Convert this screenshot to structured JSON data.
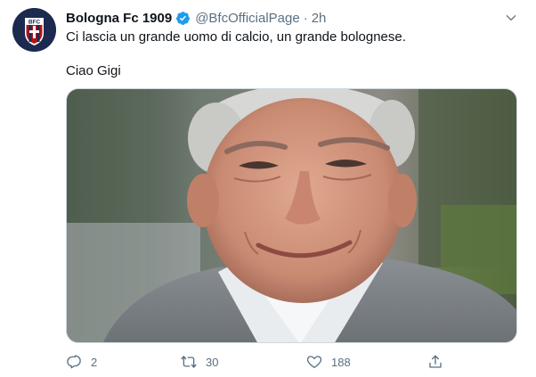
{
  "tweet": {
    "display_name": "Bologna Fc 1909",
    "handle": "@BfcOfficialPage",
    "separator": "·",
    "time": "2h",
    "text_line1": "Ci lascia un grande uomo di calcio, un grande bolognese.",
    "text_line2": "Ciao Gigi"
  },
  "avatar": {
    "logo_text": "BFC",
    "year": "1909"
  },
  "actions": {
    "reply_count": "2",
    "retweet_count": "30",
    "like_count": "188"
  },
  "colors": {
    "verified": "#1d9bf0",
    "muted": "#5b7083",
    "text": "#0f1419",
    "club_blue": "#1b2a4e",
    "club_red": "#b5121b"
  },
  "icons": [
    "verified-badge-icon",
    "chevron-down-icon",
    "reply-icon",
    "retweet-icon",
    "like-icon",
    "share-icon"
  ]
}
